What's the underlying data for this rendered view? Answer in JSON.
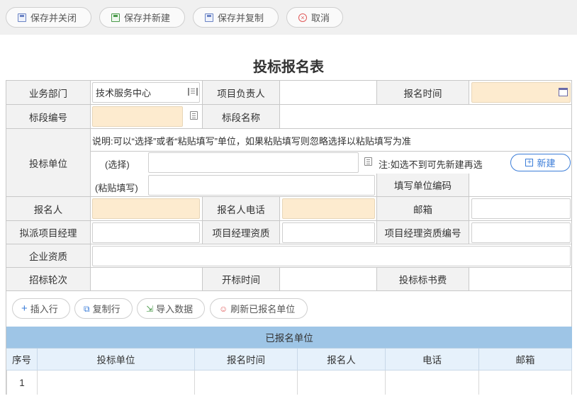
{
  "toolbar": {
    "save_close": "保存并关闭",
    "save_new": "保存并新建",
    "save_copy": "保存并复制",
    "cancel": "取消"
  },
  "form": {
    "title": "投标报名表",
    "dept_label": "业务部门",
    "dept_value": "技术服务中心",
    "pm_label": "项目负责人",
    "signup_time_label": "报名时间",
    "section_no_label": "标段编号",
    "section_name_label": "标段名称",
    "bid_unit_label": "投标单位",
    "note": "说明:可以“选择”或者“粘贴填写”单位，如果粘贴填写则忽略选择以粘贴填写为准",
    "select_label": "(选择)",
    "select_tip": "注:如选不到可先新建再选",
    "new_button": "新建",
    "paste_label": "(粘贴填写)",
    "unit_code_label": "填写单位编码",
    "signer_label": "报名人",
    "signer_phone_label": "报名人电话",
    "email_label": "邮箱",
    "proposed_pm_label": "拟派项目经理",
    "pm_qual_label": "项目经理资质",
    "pm_qual_no_label": "项目经理资质编号",
    "company_qual_label": "企业资质",
    "round_label": "招标轮次",
    "open_time_label": "开标时间",
    "doc_fee_label": "投标标书费"
  },
  "actions": {
    "insert_row": "插入行",
    "copy_row": "复制行",
    "import_data": "导入数据",
    "refresh": "刷新已报名单位"
  },
  "grid": {
    "title": "已报名单位",
    "columns": [
      "序号",
      "投标单位",
      "报名时间",
      "报名人",
      "电话",
      "邮箱"
    ],
    "rows": [
      {
        "no": "1",
        "unit": "",
        "time": "",
        "person": "",
        "phone": "",
        "email": ""
      }
    ]
  },
  "colors": {
    "required_field": "#fdebcf",
    "grid_header": "#9ec5e6",
    "grid_columns": "#e6f1fb",
    "new_button_border": "#3b7dd8"
  }
}
